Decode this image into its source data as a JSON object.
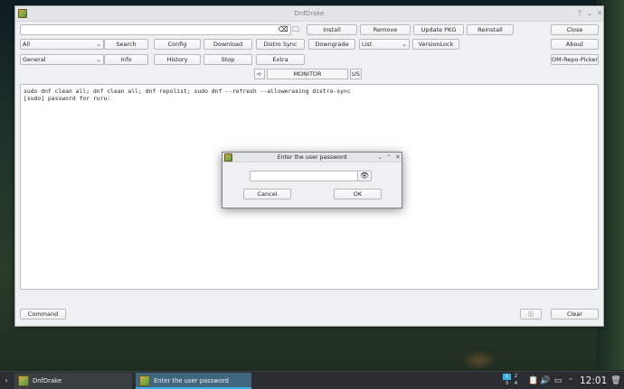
{
  "window": {
    "title": "DnfDrake"
  },
  "toolbar": {
    "install": "Install",
    "remove": "Remove",
    "update_pkg": "Update PKG",
    "reinstall": "Reinstall",
    "close": "Close",
    "filter_select": "All",
    "search": "Search",
    "config": "Config",
    "download": "Download",
    "distro_sync": "Distro Sync",
    "downgrade": "Downgrade",
    "list_select": "List",
    "versionlock": "VersionLock",
    "about": "About",
    "group_select": "General",
    "info": "Info",
    "history": "History",
    "stop": "Stop",
    "extra": "Extra",
    "om_repo_picker": "OM-Repo-Picker"
  },
  "monitor": {
    "label": "MONITOR",
    "lang": "US"
  },
  "output": {
    "lines": [
      "sudo dnf clean all; dnf clean all; dnf repolist; sudo dnf --refresh --allowerasing distro-sync",
      "[sudo] password for ruru:"
    ]
  },
  "bottom": {
    "command": "Command",
    "clear": "Clear"
  },
  "dialog": {
    "title": "Enter the user password",
    "password_value": "",
    "cancel": "Cancel",
    "ok": "OK"
  },
  "taskbar": {
    "task1": "DnfDrake",
    "task2": "Enter the user password",
    "pager": [
      "1",
      "2",
      "3",
      "4"
    ],
    "clock": "12:01"
  }
}
